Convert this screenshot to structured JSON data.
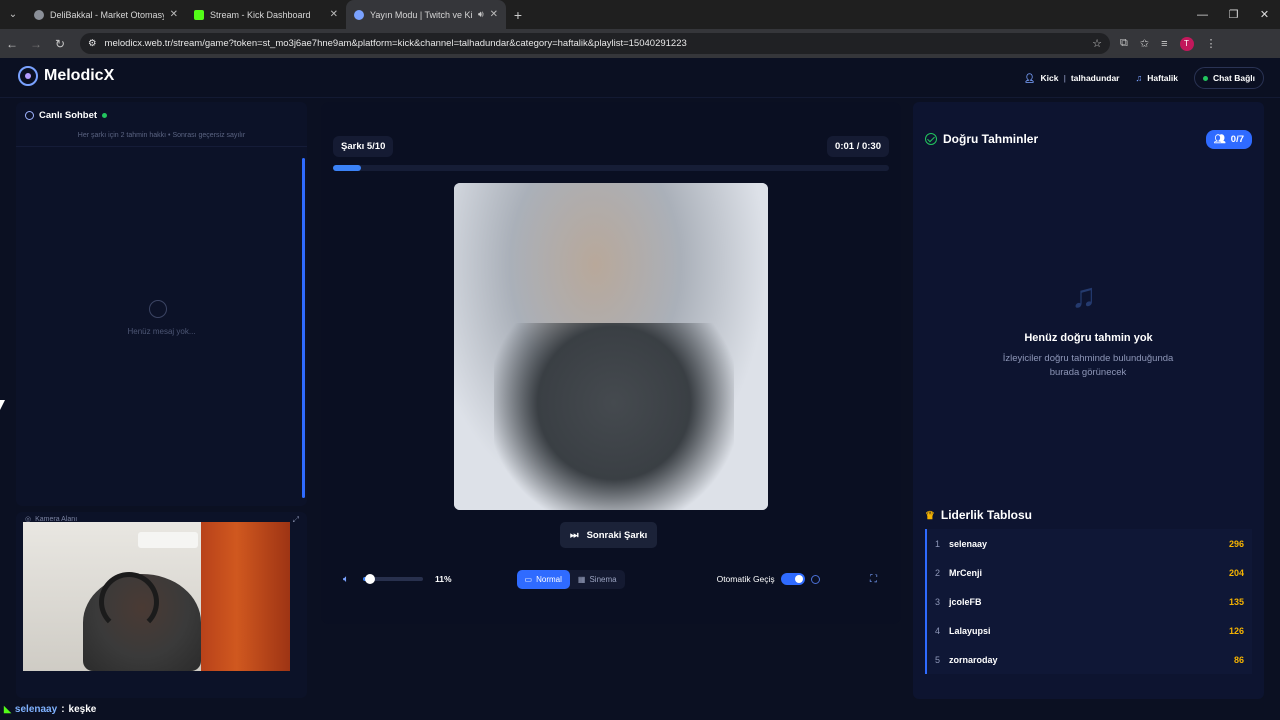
{
  "browser": {
    "tabs": [
      {
        "title": "DeliBakkal - Market Otomasyonu",
        "favicon_color": "#8a8f98"
      },
      {
        "title": "Stream - Kick Dashboard",
        "favicon_color": "#53fc18"
      },
      {
        "title": "Yayın Modu | Twitch ve Kick",
        "favicon_color": "#7aa2ff"
      }
    ],
    "url": "melodicx.web.tr/stream/game?token=st_mo3j6ae7hne9am&platform=kick&channel=talhadundar&category=haftalik&playlist=15040291223",
    "profile_initial": "T"
  },
  "header": {
    "brand": "MelodicX",
    "platform": "Kick",
    "channel": "talhadundar",
    "category": "Haftalik",
    "chat_status": "Chat Bağlı"
  },
  "chat": {
    "title": "Canlı Sohbet",
    "note": "Her şarkı için 2 tahmin hakkı • Sonrası geçersiz sayılır",
    "empty": "Henüz mesaj yok..."
  },
  "camera": {
    "label": "Kamera Alanı"
  },
  "ticker": {
    "user": "selenaay",
    "sep": ":",
    "message": "keşke"
  },
  "player": {
    "song_counter": "Şarkı 5/10",
    "elapsed": "0:01",
    "time_sep": "/",
    "duration": "0:30",
    "progress": 0.05,
    "next_label": "Sonraki Şarkı",
    "volume_label": "11%",
    "volume": 0.11,
    "modes": [
      "Normal",
      "Sinema"
    ],
    "auto_label": "Otomatik Geçiş"
  },
  "right": {
    "correct_title": "Doğru Tahminler",
    "correct_count": "0/7",
    "empty_title": "Henüz doğru tahmin yok",
    "empty_sub": "İzleyiciler doğru tahminde bulunduğunda burada görünecek",
    "leaderboard_title": "Liderlik Tablosu",
    "leaderboard": [
      {
        "rank": "1",
        "name": "selenaay",
        "score": "296"
      },
      {
        "rank": "2",
        "name": "MrCenji",
        "score": "204"
      },
      {
        "rank": "3",
        "name": "jcoleFB",
        "score": "135"
      },
      {
        "rank": "4",
        "name": "Lalayupsi",
        "score": "126"
      },
      {
        "rank": "5",
        "name": "zornaroday",
        "score": "86"
      }
    ]
  },
  "colors": {
    "accent": "#2f6bff",
    "gold": "#f5b301",
    "success": "#22c55e",
    "background": "#0b1022"
  }
}
